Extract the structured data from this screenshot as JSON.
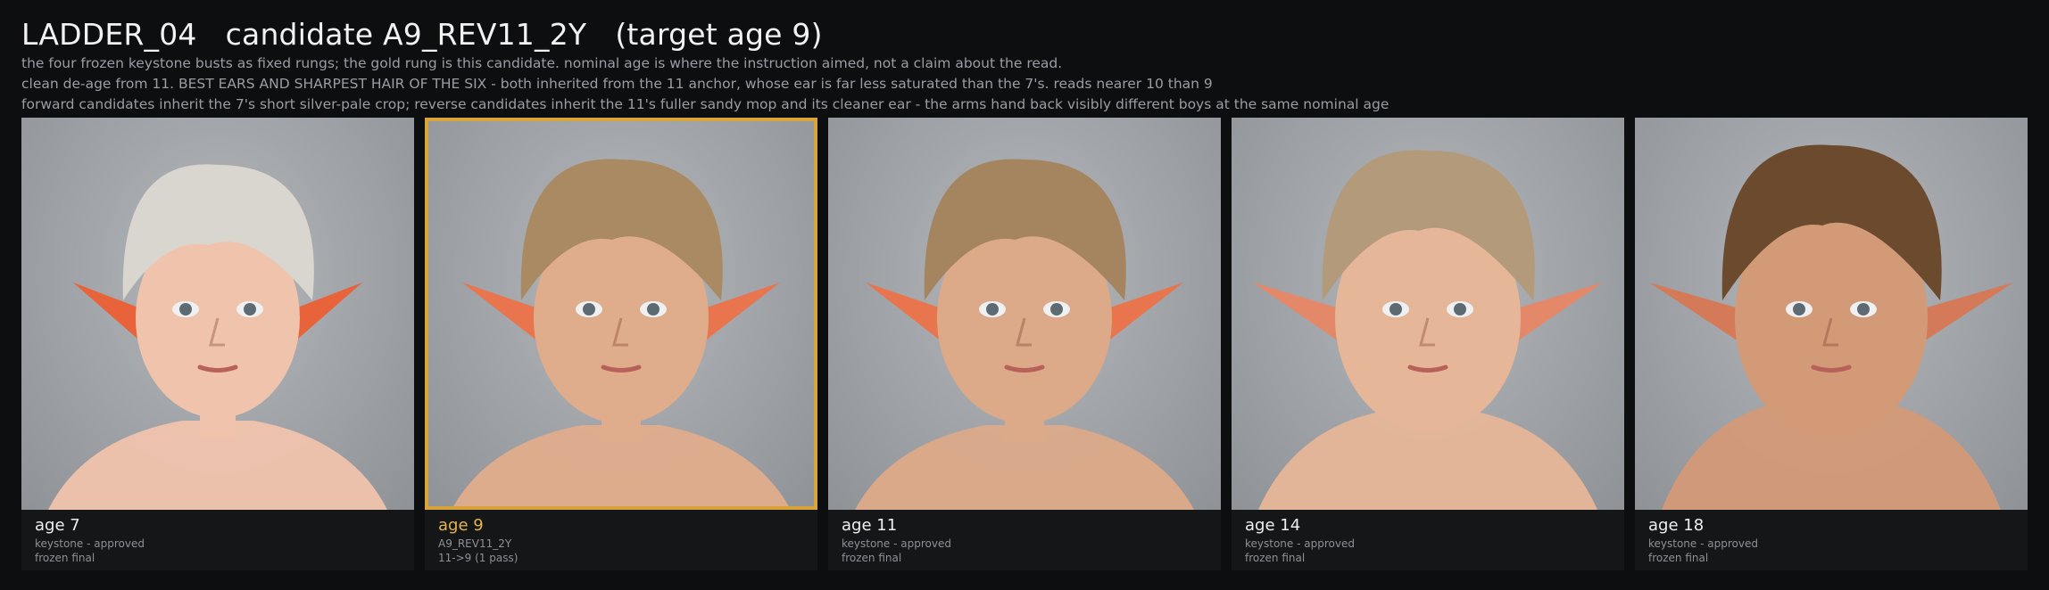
{
  "header": {
    "title": "LADDER_04   candidate A9_REV11_2Y   (target age 9)",
    "lines": [
      "the four frozen keystone busts as fixed rungs; the gold rung is this candidate.  nominal age is where the instruction aimed, not a claim about the read.",
      "clean de-age from 11.  BEST EARS AND SHARPEST HAIR OF THE SIX - both inherited from the 11 anchor, whose ear is far less saturated than the 7's.  reads nearer 10 than 9",
      "forward candidates inherit the 7's short silver-pale crop; reverse candidates inherit the 11's fuller sandy mop and its cleaner ear - the arms hand back visibly different boys at the same nominal age"
    ]
  },
  "cards": [
    {
      "age": "age 7",
      "line1": "keystone - approved",
      "line2": "frozen final",
      "selected": false,
      "hair": "#d9d6cf",
      "skin": "#f0c3ad",
      "ear": "#e8623a"
    },
    {
      "age": "age 9",
      "line1": "A9_REV11_2Y",
      "line2": "11->9  (1 pass)",
      "selected": true,
      "hair": "#a98a63",
      "skin": "#e0ad8c",
      "ear": "#e8754d"
    },
    {
      "age": "age 11",
      "line1": "keystone - approved",
      "line2": "frozen final",
      "selected": false,
      "hair": "#a48560",
      "skin": "#dcaa89",
      "ear": "#e8754d"
    },
    {
      "age": "age 14",
      "line1": "keystone - approved",
      "line2": "frozen final",
      "selected": false,
      "hair": "#b29a7a",
      "skin": "#e6b698",
      "ear": "#e4886a"
    },
    {
      "age": "age 18",
      "line1": "keystone - approved",
      "line2": "frozen final",
      "selected": false,
      "hair": "#6b4a2e",
      "skin": "#d39a78",
      "ear": "#d47a58"
    }
  ],
  "colors": {
    "background": "#0d0e10",
    "accent_gold": "#d9a437",
    "caption_bg": "#151618"
  }
}
